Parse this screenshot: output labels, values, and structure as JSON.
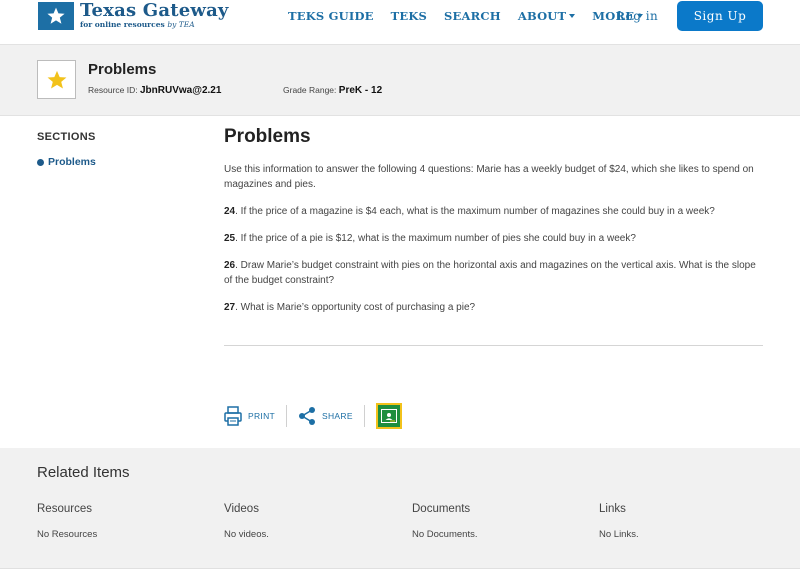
{
  "nav": {
    "logo_title": "Texas Gateway",
    "logo_sub": "for online resources",
    "logo_by": "by TEA",
    "links": [
      "TEKS GUIDE",
      "TEKS",
      "SEARCH",
      "ABOUT",
      "MORE"
    ],
    "login": "Log in",
    "signup": "Sign Up"
  },
  "resource": {
    "title": "Problems",
    "id_label": "Resource ID:",
    "id_value": "JbnRUVwa@2.21",
    "grade_label": "Grade Range:",
    "grade_value": "PreK - 12"
  },
  "sidebar": {
    "heading": "SECTIONS",
    "items": [
      "Problems"
    ]
  },
  "content": {
    "title": "Problems",
    "intro": "Use this information to answer the following 4 questions: Marie has a weekly budget of $24, which she likes to spend on magazines and pies.",
    "questions": [
      {
        "num": "24",
        "text": ". If the price of a magazine is $4 each, what is the maximum number of magazines she could buy in a week?"
      },
      {
        "num": "25",
        "text": ". If the price of a pie is $12, what is the maximum number of pies she could buy in a week?"
      },
      {
        "num": "26",
        "text": ". Draw Marie’s budget constraint with pies on the horizontal axis and magazines on the vertical axis. What is the slope of the budget constraint?"
      },
      {
        "num": "27",
        "text": ". What is Marie’s opportunity cost of purchasing a pie?"
      }
    ]
  },
  "actions": {
    "print": "PRINT",
    "share": "SHARE"
  },
  "related": {
    "heading": "Related Items",
    "columns": [
      {
        "title": "Resources",
        "value": "No Resources"
      },
      {
        "title": "Videos",
        "value": "No videos."
      },
      {
        "title": "Documents",
        "value": "No Documents."
      },
      {
        "title": "Links",
        "value": "No Links."
      }
    ]
  },
  "colors": {
    "brand": "#1d5a8a",
    "link": "#1d6fa5",
    "signup_bg": "#0b79c9",
    "star": "#f2c21b",
    "classroom": "#1e8e3e"
  }
}
